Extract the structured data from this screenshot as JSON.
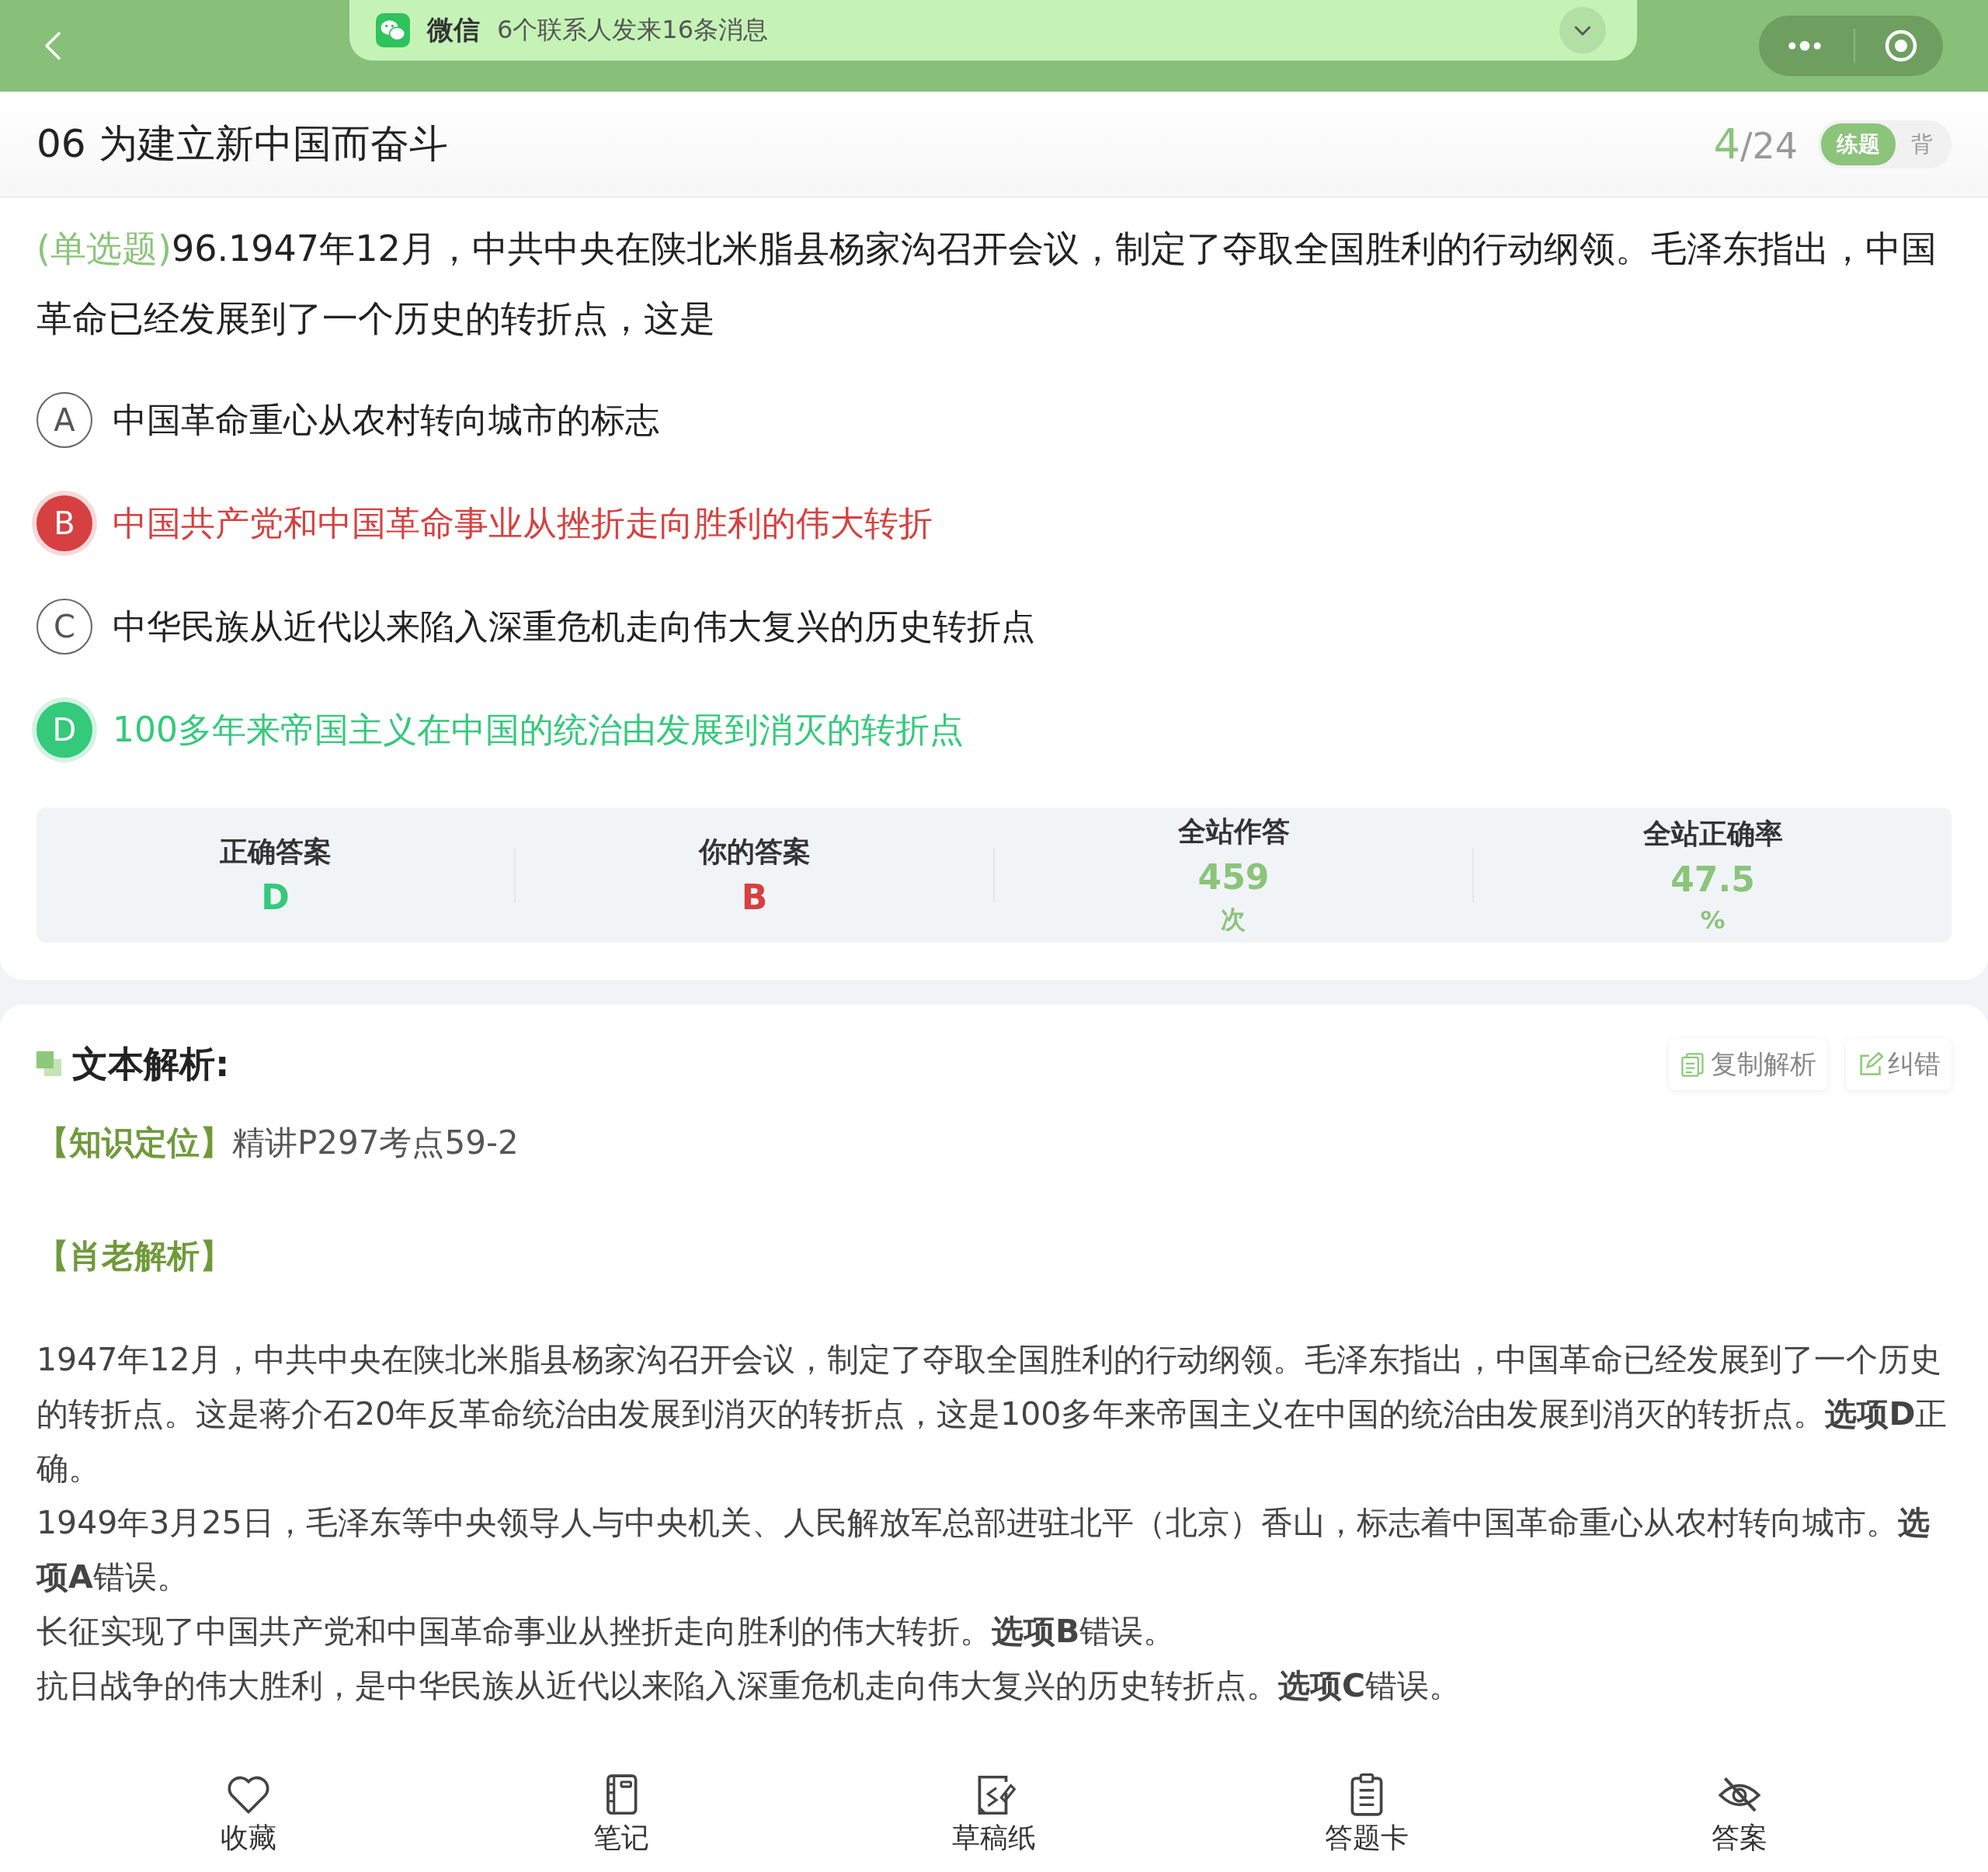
{
  "notification": {
    "app": "微信",
    "message": "6个联系人发来16条消息"
  },
  "header": {
    "title": "06 为建立新中国而奋斗",
    "current": "4",
    "total": "/24",
    "modes": [
      {
        "label": "练题",
        "selected": true
      },
      {
        "label": "背",
        "selected": false
      }
    ]
  },
  "question": {
    "type_tag": "(单选题)",
    "text": "96.1947年12月，中共中央在陕北米脂县杨家沟召开会议，制定了夺取全国胜利的行动纲领。毛泽东指出，中国革命已经发展到了一个历史的转折点，这是"
  },
  "options": [
    {
      "letter": "A",
      "text": "中国革命重心从农村转向城市的标志",
      "kind": "none"
    },
    {
      "letter": "B",
      "text": "中国共产党和中国革命事业从挫折走向胜利的伟大转折",
      "kind": "wrong"
    },
    {
      "letter": "C",
      "text": "中华民族从近代以来陷入深重危机走向伟大复兴的历史转折点",
      "kind": "none"
    },
    {
      "letter": "D",
      "text": "100多年来帝国主义在中国的统治由发展到消灭的转折点",
      "kind": "correct"
    }
  ],
  "stats": [
    {
      "label": "正确答案",
      "value": "D",
      "kind": "correct"
    },
    {
      "label": "你的答案",
      "value": "B",
      "kind": "wrong"
    },
    {
      "label": "全站作答",
      "value": "459",
      "unit": "次",
      "kind": "stat"
    },
    {
      "label": "全站正确率",
      "value": "47.5",
      "unit": "%",
      "kind": "stat"
    }
  ],
  "analysis": {
    "title": "文本解析:",
    "actions": [
      "复制解析",
      "纠错"
    ],
    "knowledge_tag": "【知识定位】",
    "knowledge": "精讲P297考点59-2",
    "teacher_tag": "【肖老解析】",
    "paragraphs": [
      "1947年12月，中共中央在陕北米脂县杨家沟召开会议，制定了夺取全国胜利的行动纲领。毛泽东指出，中国革命已经发展到了一个历史的转折点。这是蒋介石20年反革命统治由发展到消灭的转折点，这是100多年来帝国主义在中国的统治由发展到消灭的转折点。**选项D**正确。",
      "1949年3月25日，毛泽东等中央领导人与中央机关、人民解放军总部进驻北平（北京）香山，标志着中国革命重心从农村转向城市。**选项A**错误。",
      "长征实现了中国共产党和中国革命事业从挫折走向胜利的伟大转折。**选项B**错误。",
      "抗日战争的伟大胜利，是中华民族从近代以来陷入深重危机走向伟大复兴的历史转折点。**选项C**错误。"
    ]
  },
  "tabbar": [
    {
      "label": "收藏",
      "kind": "heart"
    },
    {
      "label": "笔记",
      "kind": "notebook"
    },
    {
      "label": "草稿纸",
      "kind": "draft"
    },
    {
      "label": "答题卡",
      "kind": "clipboard"
    },
    {
      "label": "答案",
      "kind": "eye-off"
    }
  ]
}
